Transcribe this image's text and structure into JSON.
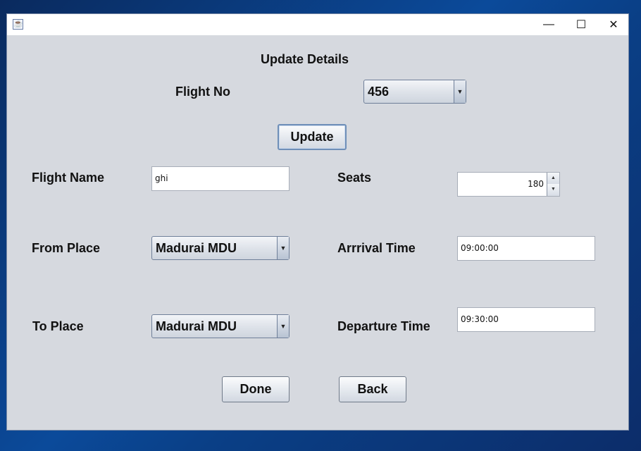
{
  "window": {
    "title_icon": "java-cup-icon",
    "controls": {
      "minimize": "—",
      "maximize": "☐",
      "close": "✕"
    }
  },
  "form": {
    "title": "Update Details",
    "flight_no_label": "Flight No",
    "flight_no_value": "456",
    "update_button": "Update",
    "flight_name_label": "Flight Name",
    "flight_name_value": "ghi",
    "seats_label": "Seats",
    "seats_value": "180",
    "from_place_label": "From Place",
    "from_place_value": "Madurai MDU",
    "arrival_time_label": "Arrrival Time",
    "arrival_time_value": "09:00:00",
    "to_place_label": "To Place",
    "to_place_value": "Madurai MDU",
    "departure_time_label": "Departure Time",
    "departure_time_value": "09:30:00",
    "done_button": "Done",
    "back_button": "Back"
  },
  "colors": {
    "window_bg": "#d6d9df",
    "desktop": "#0b4a9a"
  }
}
